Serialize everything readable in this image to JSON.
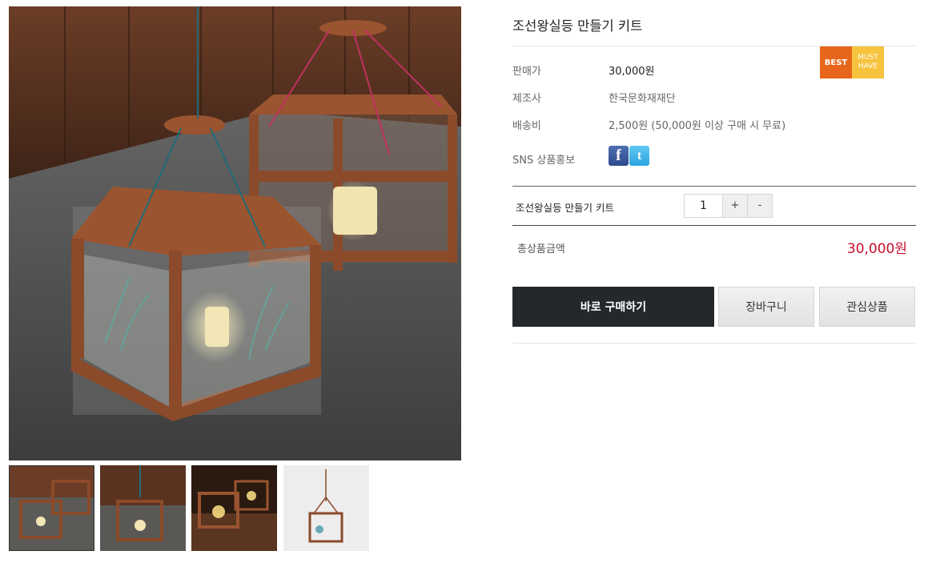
{
  "product": {
    "title": "조선왕실등 만들기 키트",
    "badges": {
      "best": "BEST",
      "must_line1": "MUST",
      "must_line2": "HAVE"
    },
    "price_label": "판매가",
    "price_value": "30,000원",
    "maker_label": "제조사",
    "maker_value": "한국문화재재단",
    "shipping_label": "배송비",
    "shipping_value": "2,500원 (50,000원 이상 구매 시 무료)",
    "sns_label": "SNS 상품홍보",
    "sns": {
      "facebook": "f",
      "twitter": "t"
    }
  },
  "option": {
    "name": "조선왕실등 만들기 키트",
    "quantity": "1",
    "plus": "+",
    "minus": "-"
  },
  "total": {
    "label": "총상품금액",
    "value": "30,000원"
  },
  "buttons": {
    "buy": "바로 구매하기",
    "cart": "장바구니",
    "wishlist": "관심상품"
  },
  "colors": {
    "best_badge": "#e8661c",
    "must_have_badge": "#f7c23d",
    "buy_button": "#23282d",
    "total_price": "#c8102e"
  }
}
